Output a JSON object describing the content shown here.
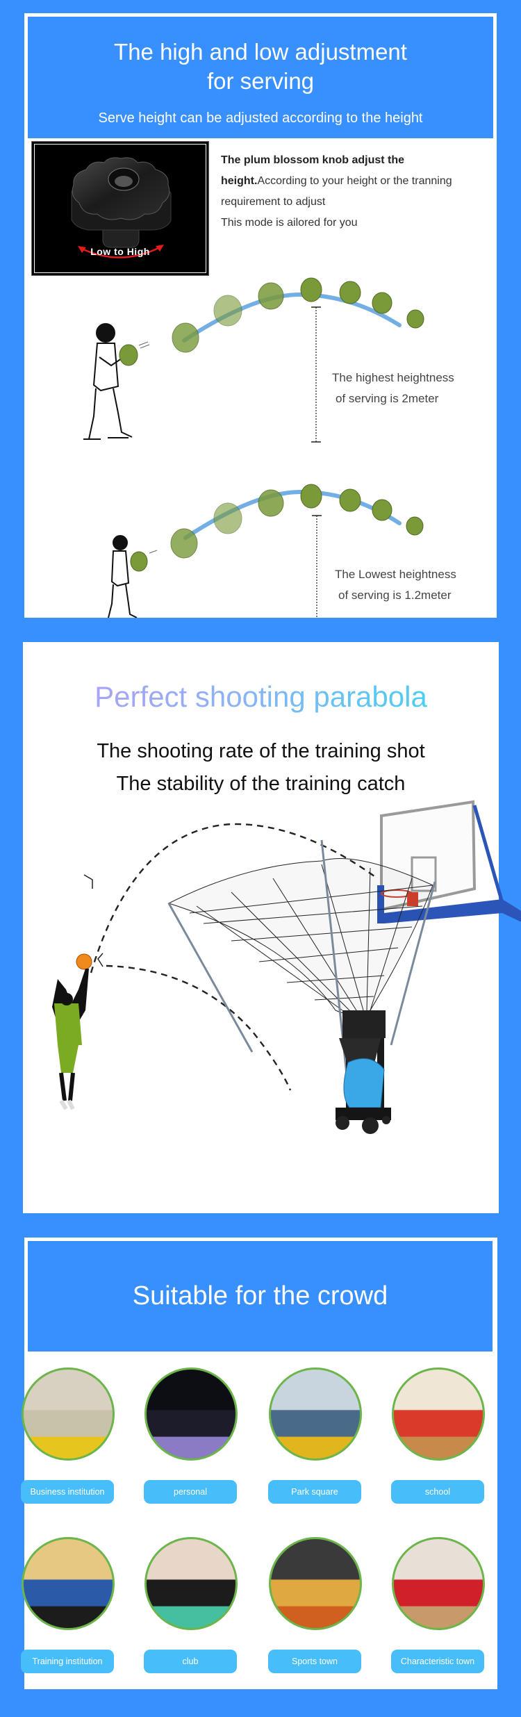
{
  "colors": {
    "page_bg": "#388ffe",
    "panel_bg": "#ffffff",
    "badge_bg": "#47bdfa",
    "photo_ring": "#6cb54a",
    "arc_blue": "#5aa0e0",
    "ball_green": "#7a9a3a",
    "title_gradient_start": "#b79bf7",
    "title_gradient_end": "#32d8f1"
  },
  "serving_section": {
    "title_line1": "The high and low adjustment",
    "title_line2": "for serving",
    "subtitle": "Serve height can be adjusted according to the height",
    "knob": {
      "label": "Low to High",
      "icon": "plum-blossom-knob-icon"
    },
    "description": {
      "bold_lead": "The plum blossom knob adjust the height.",
      "body": "According to your height or the tranning requirement to adjust",
      "line3": "This mode is ailored for you"
    },
    "highest": {
      "line1": "The highest heightness",
      "line2": "of serving is 2meter",
      "value_m": 2
    },
    "lowest": {
      "line1": "The Lowest heightness",
      "line2": "of serving is 1.2meter",
      "value_m": 1.2
    }
  },
  "parabola_section": {
    "title": "Perfect shooting parabola",
    "line1": "The shooting rate of the training shot",
    "line2": "The stability of the training catch"
  },
  "crowd_section": {
    "title": "Suitable for the crowd",
    "items": [
      {
        "label": "Business institution",
        "scene": "indoor-court-yellow-team"
      },
      {
        "label": "personal",
        "scene": "arena-night-shot"
      },
      {
        "label": "Park square",
        "scene": "outdoor-court"
      },
      {
        "label": "school",
        "scene": "school-gym-kids"
      },
      {
        "label": "Training institution",
        "scene": "training-drill-blue"
      },
      {
        "label": "club",
        "scene": "club-team-photo"
      },
      {
        "label": "Sports town",
        "scene": "stadium-dunk"
      },
      {
        "label": "Characteristic town",
        "scene": "red-gym-hall"
      }
    ]
  }
}
